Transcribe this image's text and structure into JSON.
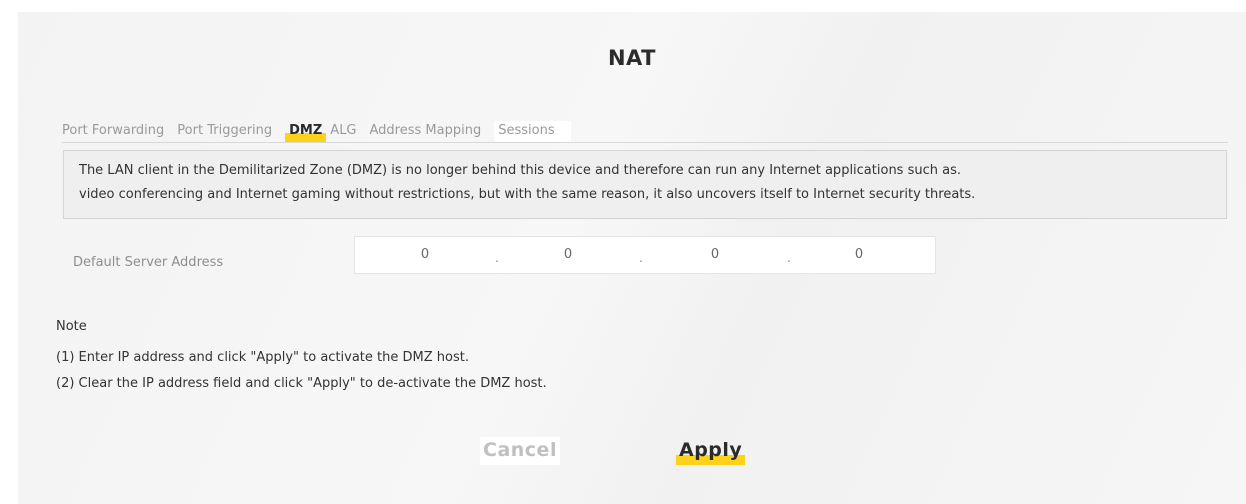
{
  "page": {
    "title": "NAT"
  },
  "tabs": [
    {
      "label": "Port Forwarding",
      "active": false
    },
    {
      "label": "Port Triggering",
      "active": false
    },
    {
      "label": "DMZ",
      "active": true
    },
    {
      "label": "ALG",
      "active": false
    },
    {
      "label": "Address Mapping",
      "active": false
    },
    {
      "label": "Sessions",
      "active": false
    }
  ],
  "info": {
    "line1": "The LAN client in the Demilitarized Zone (DMZ) is no longer behind this device and therefore can run any Internet applications such as.",
    "line2": "video conferencing and Internet gaming without restrictions, but with the same reason, it also uncovers itself to Internet security threats."
  },
  "form": {
    "default_server_label": "Default Server Address",
    "ip_octets": [
      "0",
      "0",
      "0",
      "0"
    ]
  },
  "note": {
    "title": "Note",
    "lines": [
      "(1) Enter IP address and click \"Apply\" to activate the DMZ host.",
      "(2) Clear the IP address field and click \"Apply\" to de-activate the DMZ host."
    ]
  },
  "buttons": {
    "cancel": "Cancel",
    "apply": "Apply"
  },
  "colors": {
    "accent": "#ffd21a",
    "background": "#f4f4f4"
  }
}
